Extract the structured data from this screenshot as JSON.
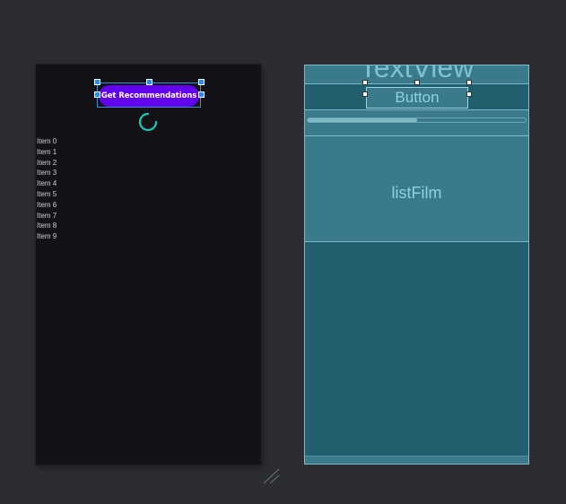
{
  "design": {
    "button_label": "Get Recommendations",
    "list_items": [
      "Item 0",
      "Item 1",
      "Item 2",
      "Item 3",
      "Item 4",
      "Item 5",
      "Item 6",
      "Item 7",
      "Item 8",
      "Item 9"
    ]
  },
  "blueprint": {
    "textview_label": "TextView",
    "button_label": "Button",
    "progress_fraction": 0.5,
    "list_label": "listFilm"
  },
  "colors": {
    "workspace_bg": "#2b2d30",
    "canvas_bg": "#131217",
    "primary_button": "#6200ee",
    "spinner": "#1fc8b6",
    "blueprint_bg": "#215e6e",
    "blueprint_region": "#3b7a8b",
    "selection_handle": "#2d8cf0"
  },
  "icons": {
    "spinner": "progress-spinner-icon",
    "resize": "resize-grip-icon"
  }
}
